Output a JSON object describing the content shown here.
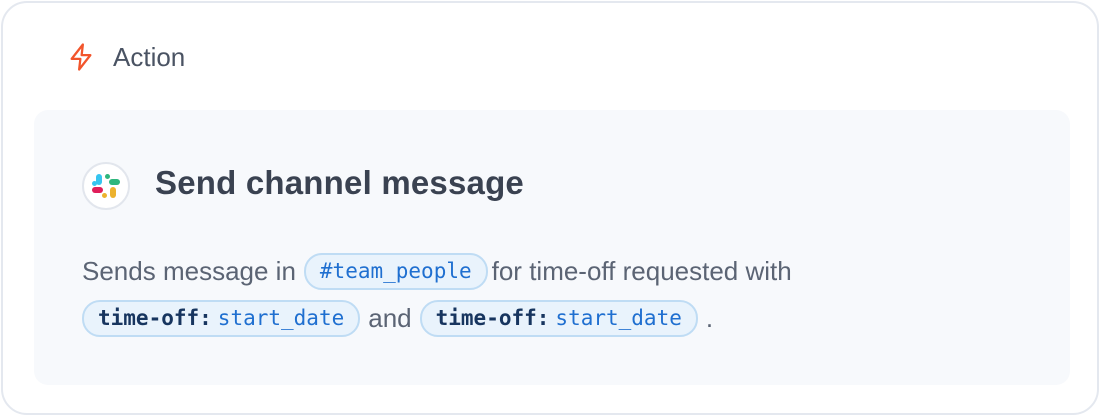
{
  "header": {
    "icon": "bolt-icon",
    "label": "Action",
    "icon_color": "#f2552c"
  },
  "action": {
    "app_icon": "slack-logo-icon",
    "title": "Send channel message",
    "description": {
      "prefix": "Sends message in",
      "channel": "#team_people",
      "middle": "for time-off requested with",
      "token1": {
        "object": "time-off:",
        "field": "start_date"
      },
      "joiner": "and",
      "token2": {
        "object": "time-off:",
        "field": "start_date"
      },
      "suffix": "."
    }
  },
  "colors": {
    "chip_text": "#1f6fd0",
    "chip_bg": "#e9f3fc",
    "chip_border": "#bfdcf4",
    "panel_bg": "#f7f9fc"
  }
}
